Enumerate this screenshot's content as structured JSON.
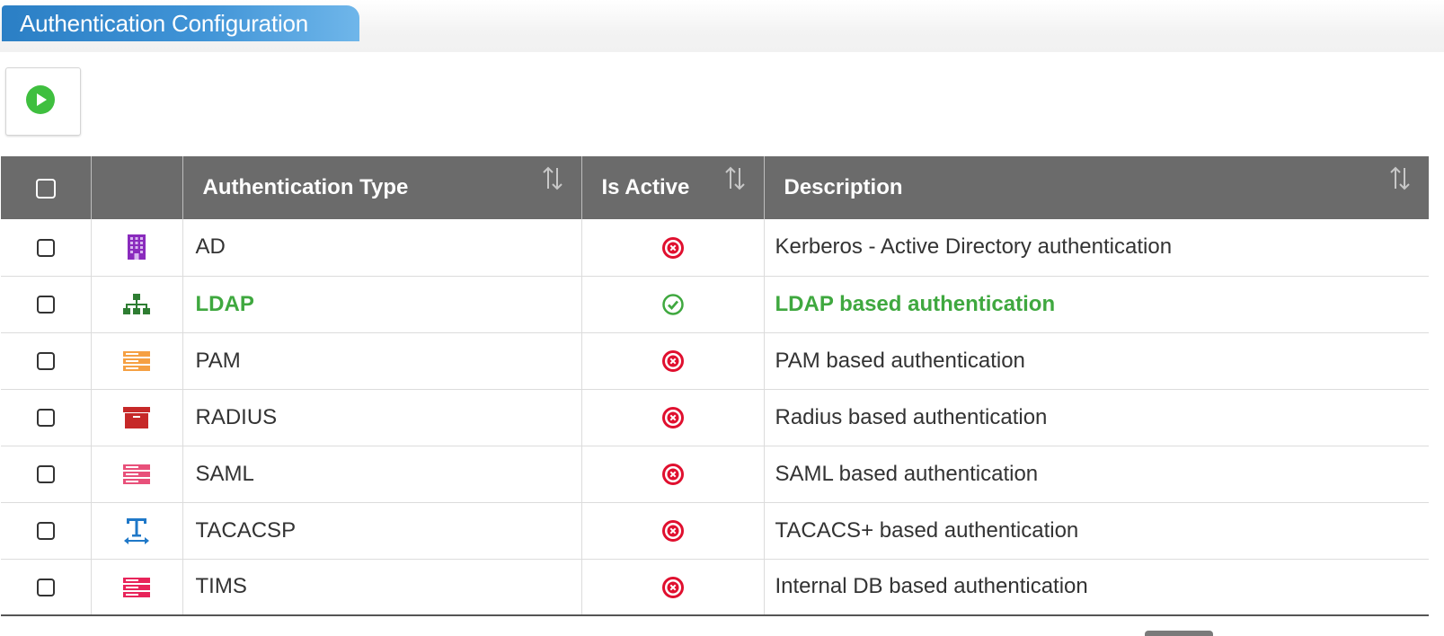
{
  "page": {
    "title": "Authentication Configuration",
    "title_gradient": [
      "#2b7fc5",
      "#6fb6ea"
    ]
  },
  "toolbar": {
    "run_icon": "play-circle-icon",
    "run_color": "#3fbf3f"
  },
  "table": {
    "header_bg": "#6b6b6b",
    "columns": [
      {
        "key": "select",
        "label": "",
        "sortable": false
      },
      {
        "key": "icon",
        "label": "",
        "sortable": false
      },
      {
        "key": "type",
        "label": "Authentication Type",
        "sortable": true
      },
      {
        "key": "active",
        "label": "Is Active",
        "sortable": true
      },
      {
        "key": "description",
        "label": "Description",
        "sortable": true
      }
    ],
    "rows": [
      {
        "type": "AD",
        "icon": "building-icon",
        "icon_color": "#8a2bbd",
        "active": false,
        "description": "Kerberos - Active Directory authentication"
      },
      {
        "type": "LDAP",
        "icon": "sitemap-icon",
        "icon_color": "#2e7d32",
        "active": true,
        "description": "LDAP based authentication"
      },
      {
        "type": "PAM",
        "icon": "server-icon",
        "icon_color": "#f5a043",
        "active": false,
        "description": "PAM based authentication"
      },
      {
        "type": "RADIUS",
        "icon": "archive-box-icon",
        "icon_color": "#c62828",
        "active": false,
        "description": "Radius based authentication"
      },
      {
        "type": "SAML",
        "icon": "server-icon",
        "icon_color": "#e8507a",
        "active": false,
        "description": "SAML based authentication"
      },
      {
        "type": "TACACSP",
        "icon": "text-width-icon",
        "icon_color": "#1f78c8",
        "active": false,
        "description": "TACACS+ based authentication"
      },
      {
        "type": "TIMS",
        "icon": "server-icon",
        "icon_color": "#e8245a",
        "active": false,
        "description": "Internal DB based authentication"
      }
    ],
    "status_colors": {
      "active": "#3fa83f",
      "inactive": "#e0102f"
    }
  }
}
